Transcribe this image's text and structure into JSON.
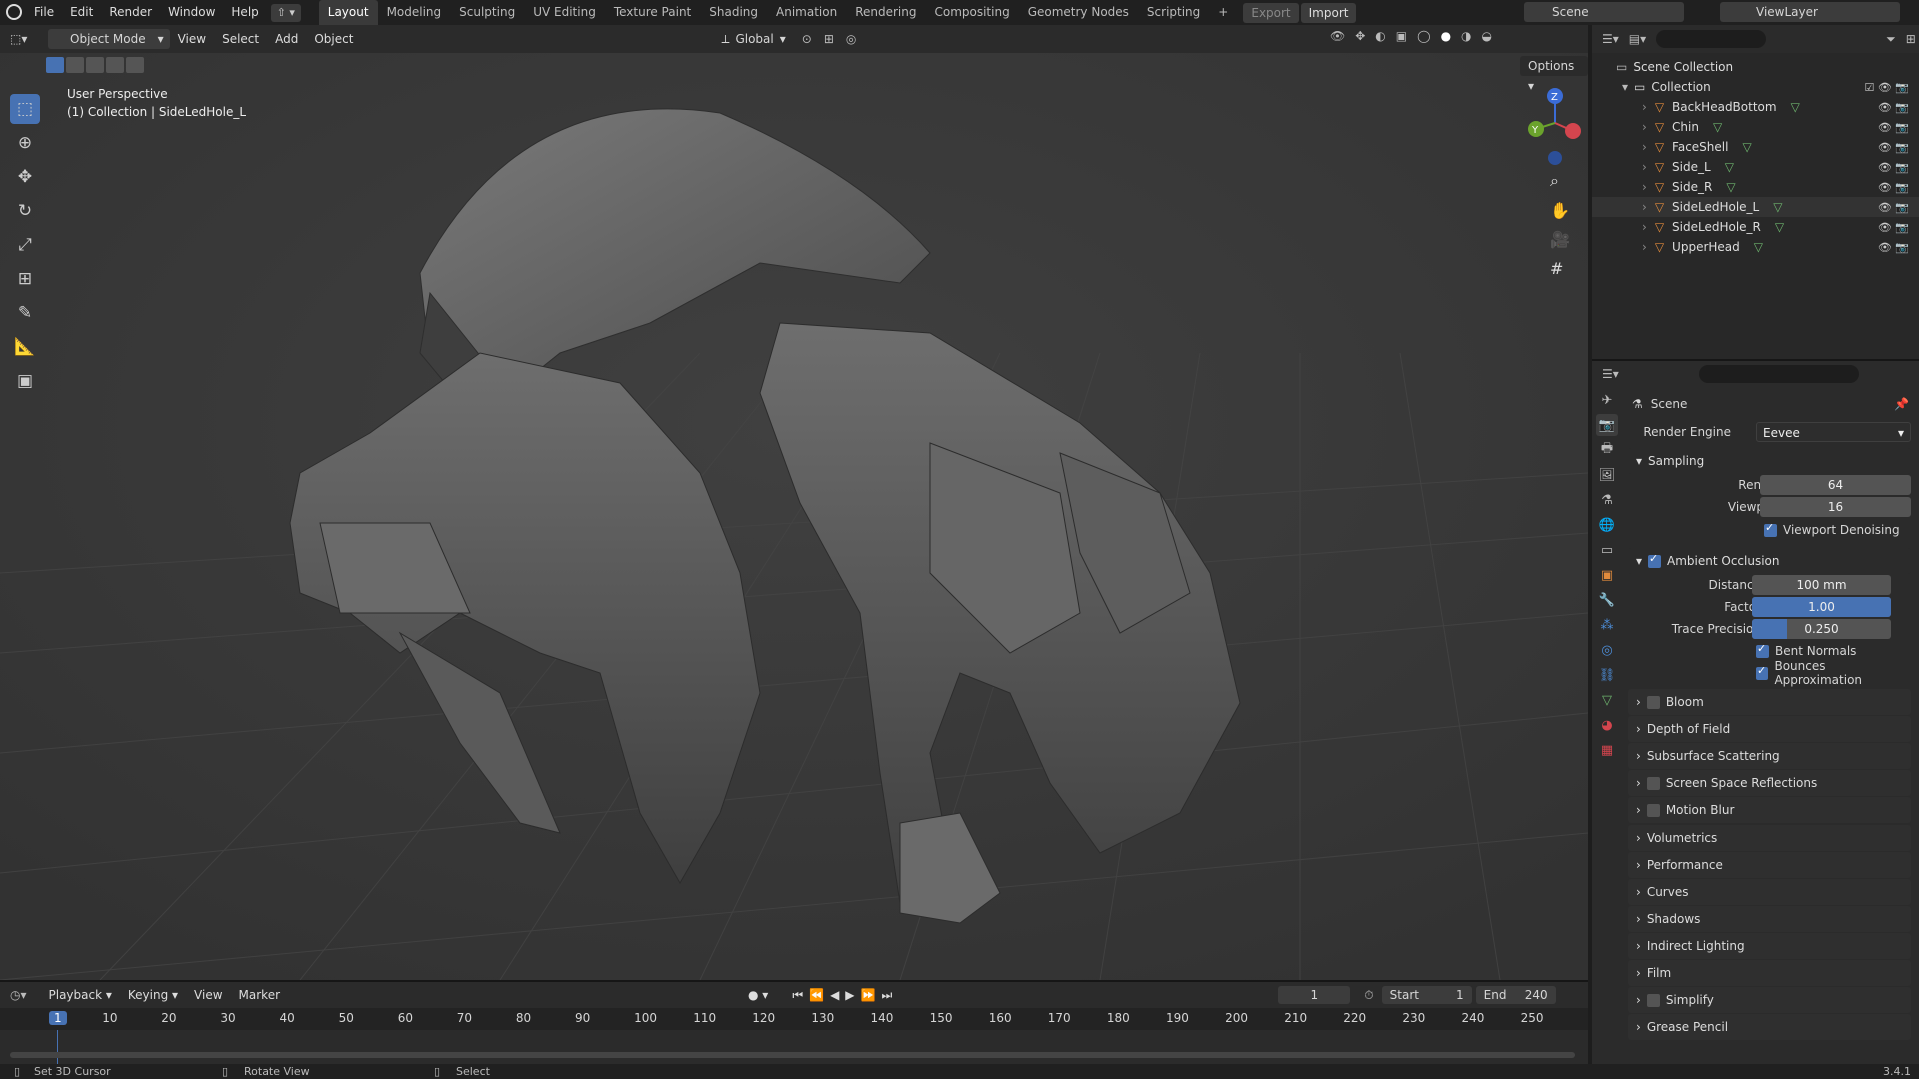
{
  "topbar": {
    "menus": [
      "File",
      "Edit",
      "Render",
      "Window",
      "Help"
    ],
    "workspaces": [
      "Layout",
      "Modeling",
      "Sculpting",
      "UV Editing",
      "Texture Paint",
      "Shading",
      "Animation",
      "Rendering",
      "Compositing",
      "Geometry Nodes",
      "Scripting"
    ],
    "add_tab": "+",
    "export_label": "Export",
    "import_label": "Import",
    "scene": "Scene",
    "view_layer": "ViewLayer"
  },
  "viewport_header": {
    "mode": "Object Mode",
    "menus": [
      "View",
      "Select",
      "Add",
      "Object"
    ],
    "orientation": "Global",
    "options": "Options"
  },
  "viewport": {
    "perspective": "User Perspective",
    "collection_info": "(1) Collection | SideLedHole_L",
    "gizmo_z": "Z",
    "gizmo_y": "Y"
  },
  "outliner": {
    "scene_collection": "Scene Collection",
    "collection": "Collection",
    "objects": [
      "BackHeadBottom",
      "Chin",
      "FaceShell",
      "Side_L",
      "Side_R",
      "SideLedHole_L",
      "SideLedHole_R",
      "UpperHead"
    ],
    "selected": "SideLedHole_L"
  },
  "properties": {
    "context": "Scene",
    "render_engine_label": "Render Engine",
    "render_engine": "Eevee",
    "sampling": {
      "title": "Sampling",
      "render_label": "Render",
      "render": "64",
      "viewport_label": "Viewport",
      "viewport": "16",
      "denoise_label": "Viewport Denoising"
    },
    "ao": {
      "title": "Ambient Occlusion",
      "distance_label": "Distance",
      "distance": "100 mm",
      "factor_label": "Factor",
      "factor": "1.00",
      "factor_fill": 1.0,
      "trace_label": "Trace Precision",
      "trace": "0.250",
      "trace_fill": 0.25,
      "bent_label": "Bent Normals",
      "bounces_label": "Bounces Approximation"
    },
    "panels": [
      {
        "label": "Bloom",
        "checkbox": true
      },
      {
        "label": "Depth of Field",
        "checkbox": false
      },
      {
        "label": "Subsurface Scattering",
        "checkbox": false
      },
      {
        "label": "Screen Space Reflections",
        "checkbox": true
      },
      {
        "label": "Motion Blur",
        "checkbox": true
      },
      {
        "label": "Volumetrics",
        "checkbox": false
      },
      {
        "label": "Performance",
        "checkbox": false
      },
      {
        "label": "Curves",
        "checkbox": false
      },
      {
        "label": "Shadows",
        "checkbox": false
      },
      {
        "label": "Indirect Lighting",
        "checkbox": false
      },
      {
        "label": "Film",
        "checkbox": false
      },
      {
        "label": "Simplify",
        "checkbox": true
      },
      {
        "label": "Grease Pencil",
        "checkbox": false
      }
    ]
  },
  "timeline": {
    "menus": [
      "Playback",
      "Keying",
      "View",
      "Marker"
    ],
    "current_frame": "1",
    "start_label": "Start",
    "start": "1",
    "end_label": "End",
    "end": "240",
    "ticks": [
      "1",
      "10",
      "20",
      "30",
      "40",
      "50",
      "60",
      "70",
      "80",
      "90",
      "100",
      "110",
      "120",
      "130",
      "140",
      "150",
      "160",
      "170",
      "180",
      "190",
      "200",
      "210",
      "220",
      "230",
      "240",
      "250"
    ]
  },
  "status": {
    "items": [
      "Set 3D Cursor",
      "Rotate View",
      "Select"
    ],
    "version": "3.4.1"
  },
  "colors": {
    "accent": "#4772b3",
    "object_orange": "#e08a3c",
    "mesh_green": "#6db36d",
    "viewport_bg": "#3a3a3a"
  }
}
